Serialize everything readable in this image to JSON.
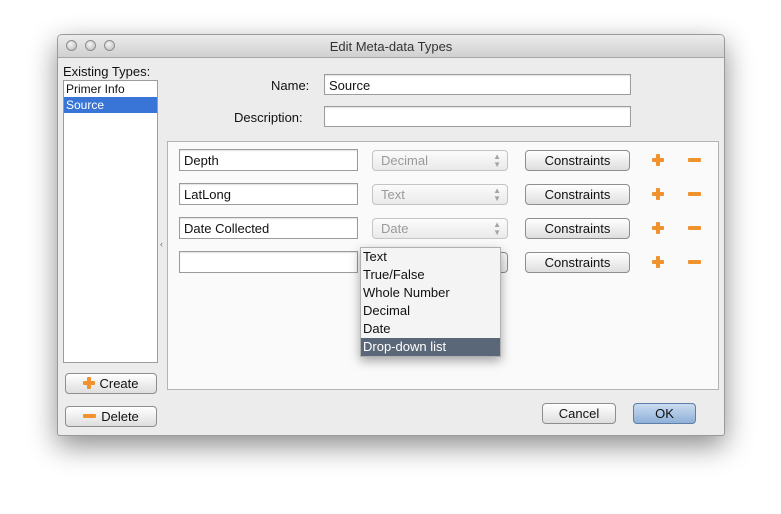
{
  "window": {
    "title": "Edit Meta-data Types"
  },
  "sidebar": {
    "heading": "Existing Types:",
    "items": [
      {
        "label": "Primer Info",
        "selected": false
      },
      {
        "label": "Source",
        "selected": true
      }
    ],
    "create_label": "Create",
    "delete_label": "Delete"
  },
  "form": {
    "name_label": "Name:",
    "name_value": "Source",
    "description_label": "Description:",
    "description_value": ""
  },
  "rows": [
    {
      "name": "Depth",
      "type": "Decimal",
      "constraints_label": "Constraints"
    },
    {
      "name": "LatLong",
      "type": "Text",
      "constraints_label": "Constraints"
    },
    {
      "name": "Date Collected",
      "type": "Date",
      "constraints_label": "Constraints"
    },
    {
      "name": "",
      "type": "",
      "constraints_label": "Constraints"
    }
  ],
  "dropdown": {
    "options": [
      "Text",
      "True/False",
      "Whole Number",
      "Decimal",
      "Date",
      "Drop-down list"
    ],
    "highlighted": "Drop-down list"
  },
  "footer": {
    "cancel_label": "Cancel",
    "ok_label": "OK"
  },
  "colors": {
    "accent_orange": "#f0922e",
    "selection_blue": "#3875d7",
    "menu_highlight": "#5a6778"
  },
  "icons": {
    "add": "plus-icon",
    "remove": "minus-icon",
    "select": "updown-arrows-icon"
  }
}
